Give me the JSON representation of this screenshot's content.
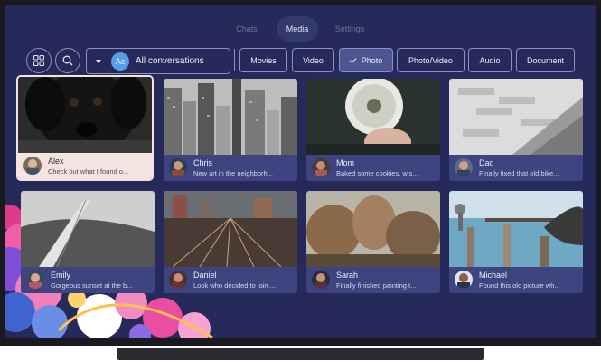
{
  "tabs": [
    "Chats",
    "Media",
    "Settings"
  ],
  "active_tab": "Media",
  "toolbar": {
    "conversation_initials": "Ac",
    "conversation_label": "All conversations",
    "filters": [
      "Movies",
      "Video",
      "Photo",
      "Photo/Video",
      "Audio",
      "Document"
    ],
    "selected_filter": "Photo"
  },
  "media": [
    {
      "name": "Alex",
      "message": "Check out what I found o...",
      "photo": "black-puppy",
      "selected": true
    },
    {
      "name": "Chris",
      "message": "New art in the neighborh...",
      "photo": "city-skyline",
      "selected": false
    },
    {
      "name": "Mom",
      "message": "Baked some cookies, wis...",
      "photo": "dandelion",
      "selected": false
    },
    {
      "name": "Dad",
      "message": "Finally fixed that old bike...",
      "photo": "stone-stairs",
      "selected": false
    },
    {
      "name": "Emily",
      "message": "Gorgeous sunset at the b...",
      "photo": "railway-hill",
      "selected": false
    },
    {
      "name": "Daniel",
      "message": "Look who decided to join ...",
      "photo": "rail-yard",
      "selected": false
    },
    {
      "name": "Sarah",
      "message": "Finally finished painting t...",
      "photo": "autumn-trees",
      "selected": false
    },
    {
      "name": "Michael",
      "message": "Found this old picture wh...",
      "photo": "pier-bird",
      "selected": false
    }
  ],
  "colors": {
    "screen_background": "#262a5a",
    "tile_bar": "#3d4480",
    "selected_tile": "#f3e4e1",
    "selected_chip": "#4e5392",
    "accent_avatar": "#5a9ce6"
  }
}
